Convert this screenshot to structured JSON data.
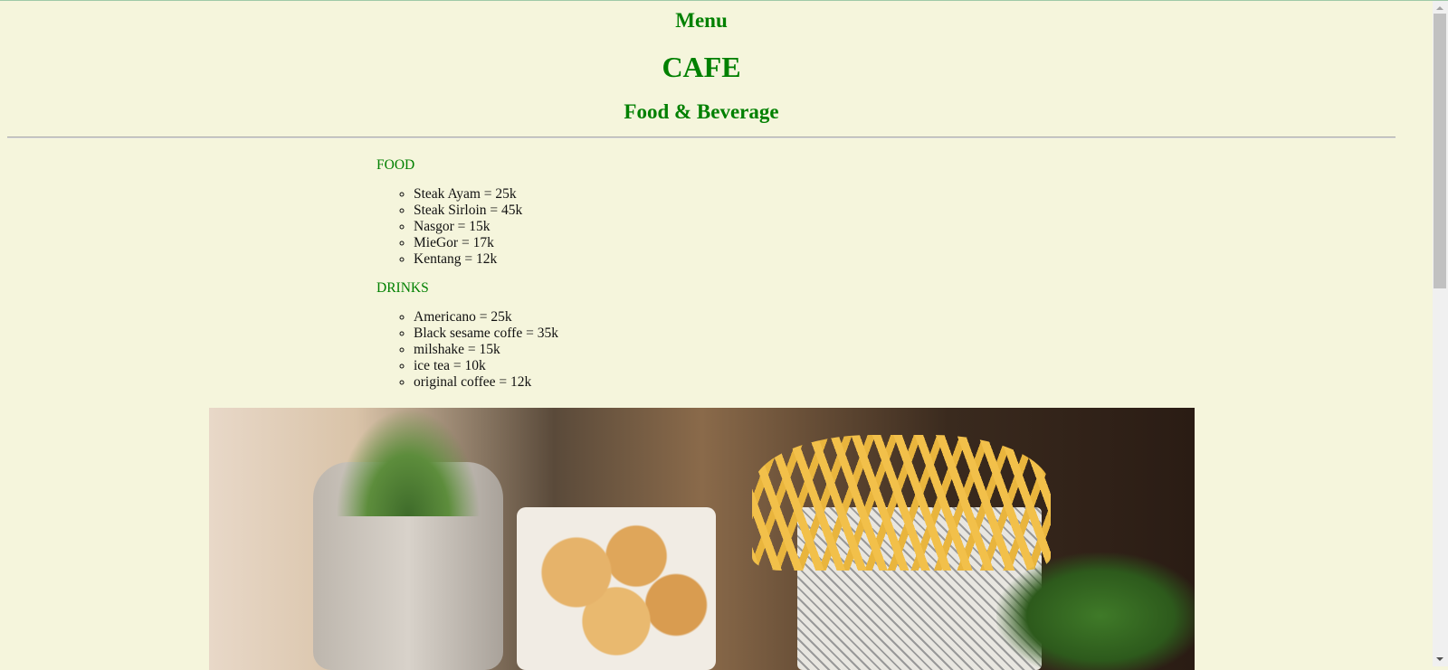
{
  "header": {
    "menu": "Menu",
    "title": "CAFE",
    "subtitle": "Food & Beverage"
  },
  "food": {
    "label": "FOOD",
    "items": [
      "Steak Ayam = 25k",
      "Steak Sirloin = 45k",
      "Nasgor = 15k",
      "MieGor = 17k",
      "Kentang = 12k"
    ]
  },
  "drinks": {
    "label": "DRINKS",
    "items": [
      "Americano = 25k",
      "Black sesame coffe = 35k",
      "milshake = 15k",
      "ice tea = 10k",
      "original coffee = 12k"
    ]
  },
  "colors": {
    "background": "#f5f5dc",
    "heading": "#008000"
  }
}
